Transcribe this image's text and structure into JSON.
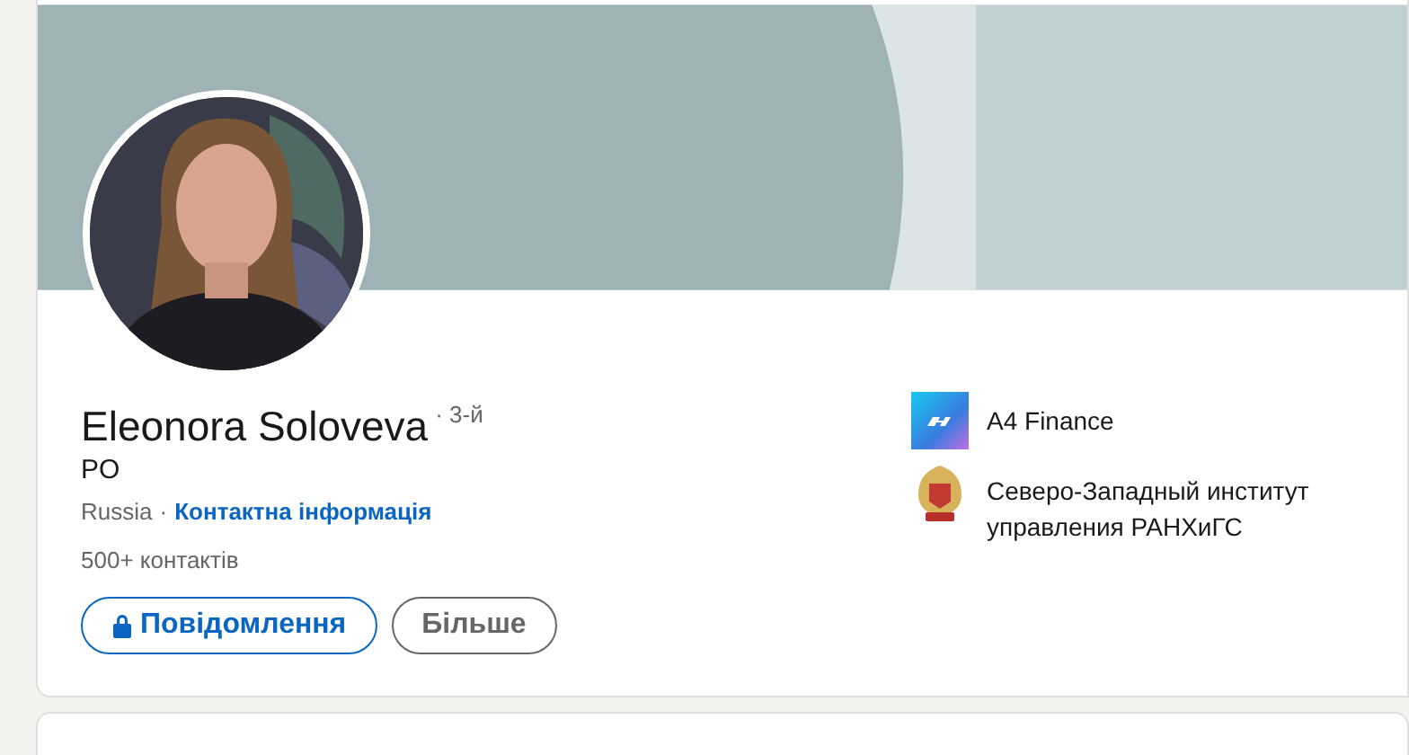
{
  "profile": {
    "name": "Eleonora Soloveva",
    "degree": "· 3-й",
    "headline": "PO",
    "location": "Russia",
    "separator": "·",
    "contact_link": "Контактна інформація",
    "connections": "500+ контактів"
  },
  "buttons": [
    {
      "kind": "primary",
      "label": "Повідомлення"
    },
    {
      "kind": "secondary",
      "label": "Більше"
    }
  ],
  "experience": [
    {
      "kind": "company",
      "name": "A4 Finance"
    },
    {
      "kind": "school",
      "name": "Северо-Западный институт управления РАНХиГС"
    }
  ]
}
